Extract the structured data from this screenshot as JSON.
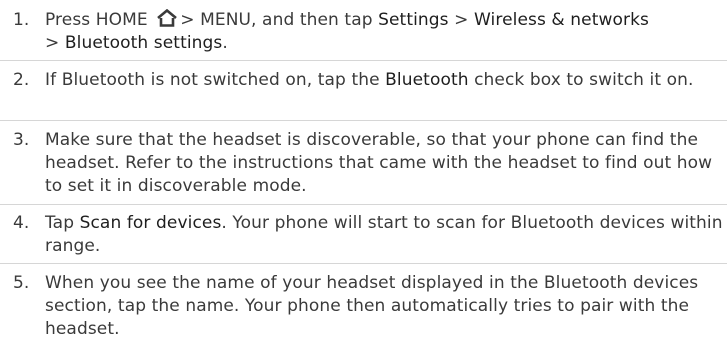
{
  "steps": [
    {
      "number": "1.",
      "segments": [
        {
          "type": "text",
          "text": "Press HOME "
        },
        {
          "type": "icon",
          "icon": "home-icon"
        },
        {
          "type": "text",
          "text": "> MENU, and then tap "
        },
        {
          "type": "emph",
          "text": "Settings"
        },
        {
          "type": "text",
          "text": " > "
        },
        {
          "type": "emph",
          "text": "Wireless & networks"
        },
        {
          "type": "text",
          "text": " > "
        },
        {
          "type": "emph",
          "text": "Bluetooth settings"
        },
        {
          "type": "text",
          "text": "."
        }
      ]
    },
    {
      "number": "2.",
      "segments": [
        {
          "type": "text",
          "text": "If Bluetooth is not switched on, tap the "
        },
        {
          "type": "emph",
          "text": "Bluetooth"
        },
        {
          "type": "text",
          "text": " check box to switch it on."
        }
      ]
    },
    {
      "number": "3.",
      "segments": [
        {
          "type": "text",
          "text": "Make sure that the headset is discoverable, so that your phone can find the headset. Refer to the instructions that came with the headset to find out how to set it in discoverable mode."
        }
      ]
    },
    {
      "number": "4.",
      "segments": [
        {
          "type": "text",
          "text": "Tap "
        },
        {
          "type": "emph",
          "text": "Scan for devices"
        },
        {
          "type": "text",
          "text": ". Your phone will start to scan for Bluetooth devices within range."
        }
      ]
    },
    {
      "number": "5.",
      "segments": [
        {
          "type": "text",
          "text": "When you see the name of your headset displayed in the Bluetooth devices section, tap the name. Your phone then automatically tries to pair with the headset."
        }
      ]
    }
  ]
}
